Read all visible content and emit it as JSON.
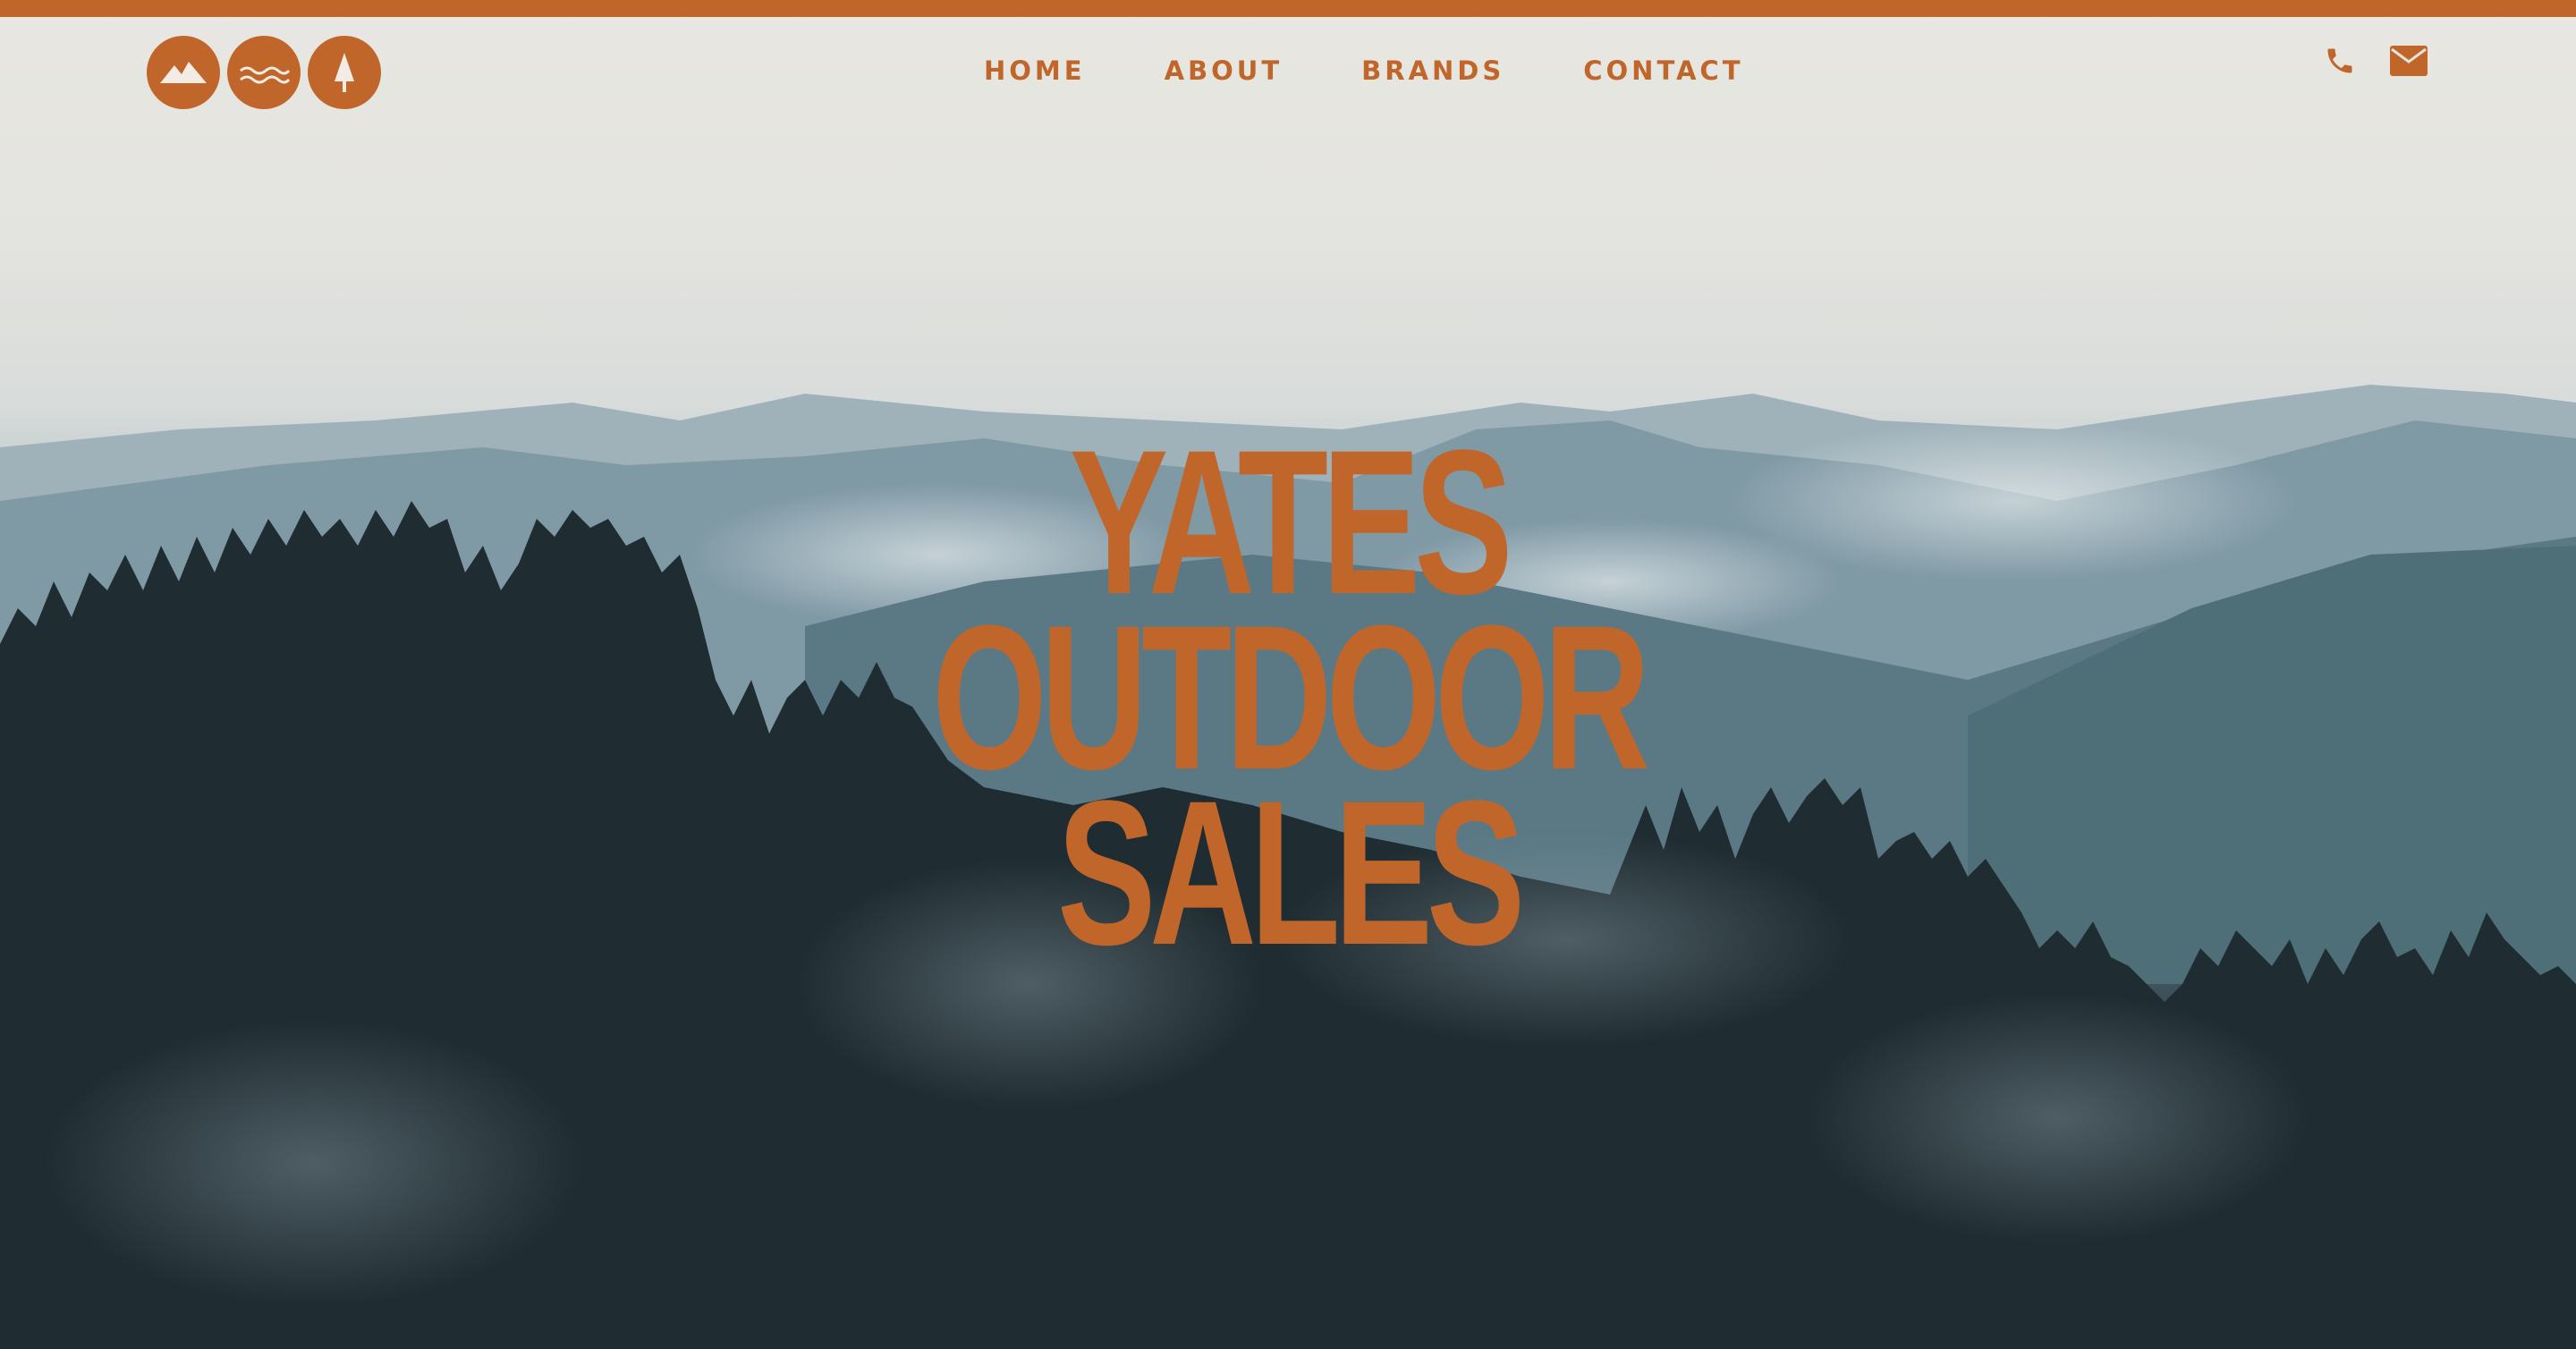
{
  "theme": {
    "accent": "#c0662a"
  },
  "logo": {
    "icons": [
      "mountain-icon",
      "waves-icon",
      "tree-icon"
    ]
  },
  "nav": {
    "items": [
      {
        "label": "HOME"
      },
      {
        "label": "ABOUT"
      },
      {
        "label": "BRANDS"
      },
      {
        "label": "CONTACT"
      }
    ]
  },
  "contact": {
    "icons": [
      "phone-icon",
      "envelope-icon"
    ]
  },
  "hero": {
    "title_lines": [
      "YATES",
      "OUTDOOR",
      "SALES"
    ]
  }
}
